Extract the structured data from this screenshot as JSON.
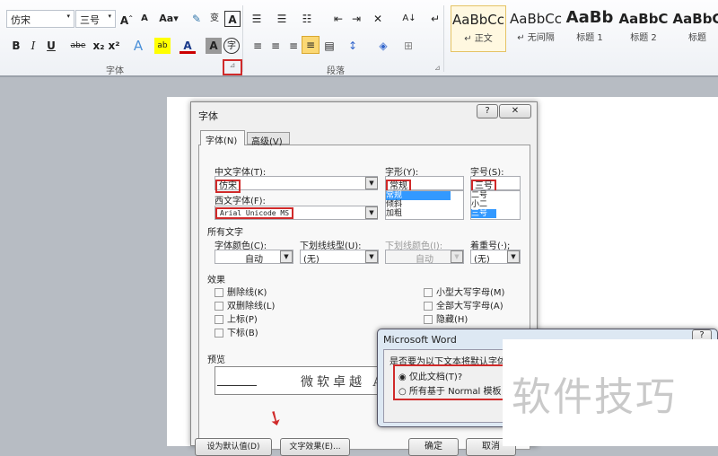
{
  "ribbon": {
    "font_name": "仿宋",
    "font_size": "三号",
    "font_group_label": "字体",
    "paragraph_group_label": "段落",
    "styles": [
      {
        "sample": "AaBbCc",
        "label": "↵ 正文"
      },
      {
        "sample": "AaBbCc",
        "label": "↵ 无间隔"
      },
      {
        "sample": "AaBb",
        "label": "标题 1"
      },
      {
        "sample": "AaBbC",
        "label": "标题 2"
      },
      {
        "sample": "AaBbC",
        "label": "标题"
      }
    ],
    "icons": [
      "grow-font",
      "shrink-font",
      "change-case",
      "clear-format",
      "phonetic-guide",
      "char-border",
      "bold",
      "italic",
      "underline",
      "strikethrough",
      "subscript",
      "superscript",
      "text-effect",
      "highlight",
      "font-color",
      "char-shading",
      "enclose-char",
      "bullets",
      "numbering",
      "multilevel-list",
      "decrease-indent",
      "increase-indent",
      "chinese-layout",
      "sort",
      "show-marks",
      "align-left",
      "center",
      "align-right",
      "justify",
      "distributed",
      "line-spacing",
      "shading",
      "borders"
    ]
  },
  "font_dialog": {
    "title": "字体",
    "help": "?",
    "close": "✕",
    "tabs": [
      "字体(N)",
      "高级(V)"
    ],
    "chinese_font_label": "中文字体(T):",
    "chinese_font_value": "仿宋",
    "western_font_label": "西文字体(F):",
    "western_font_value": "Arial Unicode MS",
    "style_label": "字形(Y):",
    "style_value": "常规",
    "style_options": [
      "常规",
      "倾斜",
      "加粗"
    ],
    "size_label": "字号(S):",
    "size_value": "三号",
    "size_options": [
      "二号",
      "小二",
      "三号"
    ],
    "all_text_label": "所有文字",
    "font_color_label": "字体颜色(C):",
    "font_color_value": "自动",
    "underline_style_label": "下划线线型(U):",
    "underline_style_value": "(无)",
    "underline_color_label": "下划线颜色(I):",
    "underline_color_value": "自动",
    "emphasis_label": "着重号(·);",
    "emphasis_value": "(无)",
    "effects_label": "效果",
    "effects_left": [
      "删除线(K)",
      "双删除线(L)",
      "上标(P)",
      "下标(B)"
    ],
    "effects_right": [
      "小型大写字母(M)",
      "全部大写字母(A)",
      "隐藏(H)"
    ],
    "preview_label": "预览",
    "preview_text": "微软卓越 A",
    "buttons": [
      "设为默认值(D)",
      "文字效果(E)...",
      "确定",
      "取消"
    ]
  },
  "confirm_dialog": {
    "title": "Microsoft Word",
    "help": "?",
    "question": "是否要为以下文本将默认字体",
    "options": [
      "仅此文档(T)?",
      "所有基于 Normal 模板"
    ],
    "selected": 0
  },
  "watermark": "软件技巧",
  "colors": {
    "highlight_red": "#d02a2a",
    "selection_blue": "#3399ff"
  }
}
